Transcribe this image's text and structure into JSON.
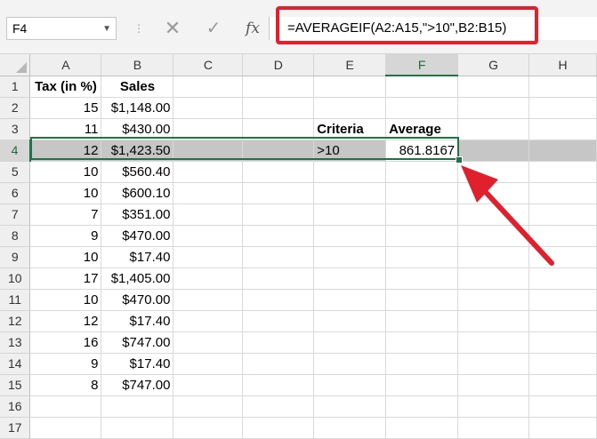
{
  "name_box": "F4",
  "formula_bar": {
    "cancel_icon": "close-icon",
    "enter_icon": "check-icon",
    "fx_label": "fx",
    "formula": "=AVERAGEIF(A2:A15,\">10\",B2:B15)"
  },
  "columns": [
    "A",
    "B",
    "C",
    "D",
    "E",
    "F",
    "G",
    "H"
  ],
  "rows": [
    {
      "n": "1",
      "A": "Tax (in %)",
      "B": "Sales",
      "E": "",
      "F": ""
    },
    {
      "n": "2",
      "A": "15",
      "B": "$1,148.00",
      "E": "",
      "F": ""
    },
    {
      "n": "3",
      "A": "11",
      "B": "$430.00",
      "E": "Criteria",
      "F": "Average"
    },
    {
      "n": "4",
      "A": "12",
      "B": "$1,423.50",
      "E": ">10",
      "F": "861.8167"
    },
    {
      "n": "5",
      "A": "10",
      "B": "$560.40",
      "E": "",
      "F": ""
    },
    {
      "n": "6",
      "A": "10",
      "B": "$600.10",
      "E": "",
      "F": ""
    },
    {
      "n": "7",
      "A": "7",
      "B": "$351.00",
      "E": "",
      "F": ""
    },
    {
      "n": "8",
      "A": "9",
      "B": "$470.00",
      "E": "",
      "F": ""
    },
    {
      "n": "9",
      "A": "10",
      "B": "$17.40",
      "E": "",
      "F": ""
    },
    {
      "n": "10",
      "A": "17",
      "B": "$1,405.00",
      "E": "",
      "F": ""
    },
    {
      "n": "11",
      "A": "10",
      "B": "$470.00",
      "E": "",
      "F": ""
    },
    {
      "n": "12",
      "A": "12",
      "B": "$17.40",
      "E": "",
      "F": ""
    },
    {
      "n": "13",
      "A": "16",
      "B": "$747.00",
      "E": "",
      "F": ""
    },
    {
      "n": "14",
      "A": "9",
      "B": "$17.40",
      "E": "",
      "F": ""
    },
    {
      "n": "15",
      "A": "8",
      "B": "$747.00",
      "E": "",
      "F": ""
    },
    {
      "n": "16",
      "A": "",
      "B": "",
      "E": "",
      "F": ""
    },
    {
      "n": "17",
      "A": "",
      "B": "",
      "E": "",
      "F": ""
    }
  ],
  "selected_row": "4",
  "selected_column": "F",
  "colors": {
    "accent": "#217346",
    "annotation": "#e0212d"
  }
}
